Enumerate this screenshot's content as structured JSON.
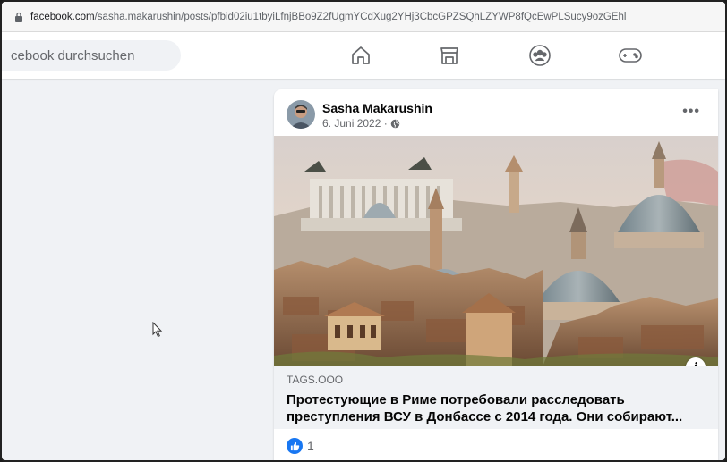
{
  "browser": {
    "url_host": "facebook.com",
    "url_path": "/sasha.makarushin/posts/pfbid02iu1tbyiLfnjBBo9Z2fUgmYCdXug2YHj3CbcGPZSQhLZYWP8fQcEwPLSucy9ozGEhl"
  },
  "header": {
    "search_text": "cebook durchsuchen",
    "nav_icons": [
      "home-icon",
      "marketplace-icon",
      "groups-icon",
      "gaming-icon"
    ]
  },
  "post": {
    "author": "Sasha Makarushin",
    "date": "6. Juni 2022 ·",
    "more_label": "•••",
    "link": {
      "source": "TAGS.OOO",
      "headline": "Протестующие в Риме потребовали расследовать преступления ВСУ в Донбассе с 2014 года. Они собирают..."
    },
    "info_label": "i",
    "reaction_count": "1"
  },
  "colors": {
    "accent": "#1877f2",
    "page_bg": "#f0f2f5",
    "text_primary": "#050505",
    "text_secondary": "#65676b"
  }
}
